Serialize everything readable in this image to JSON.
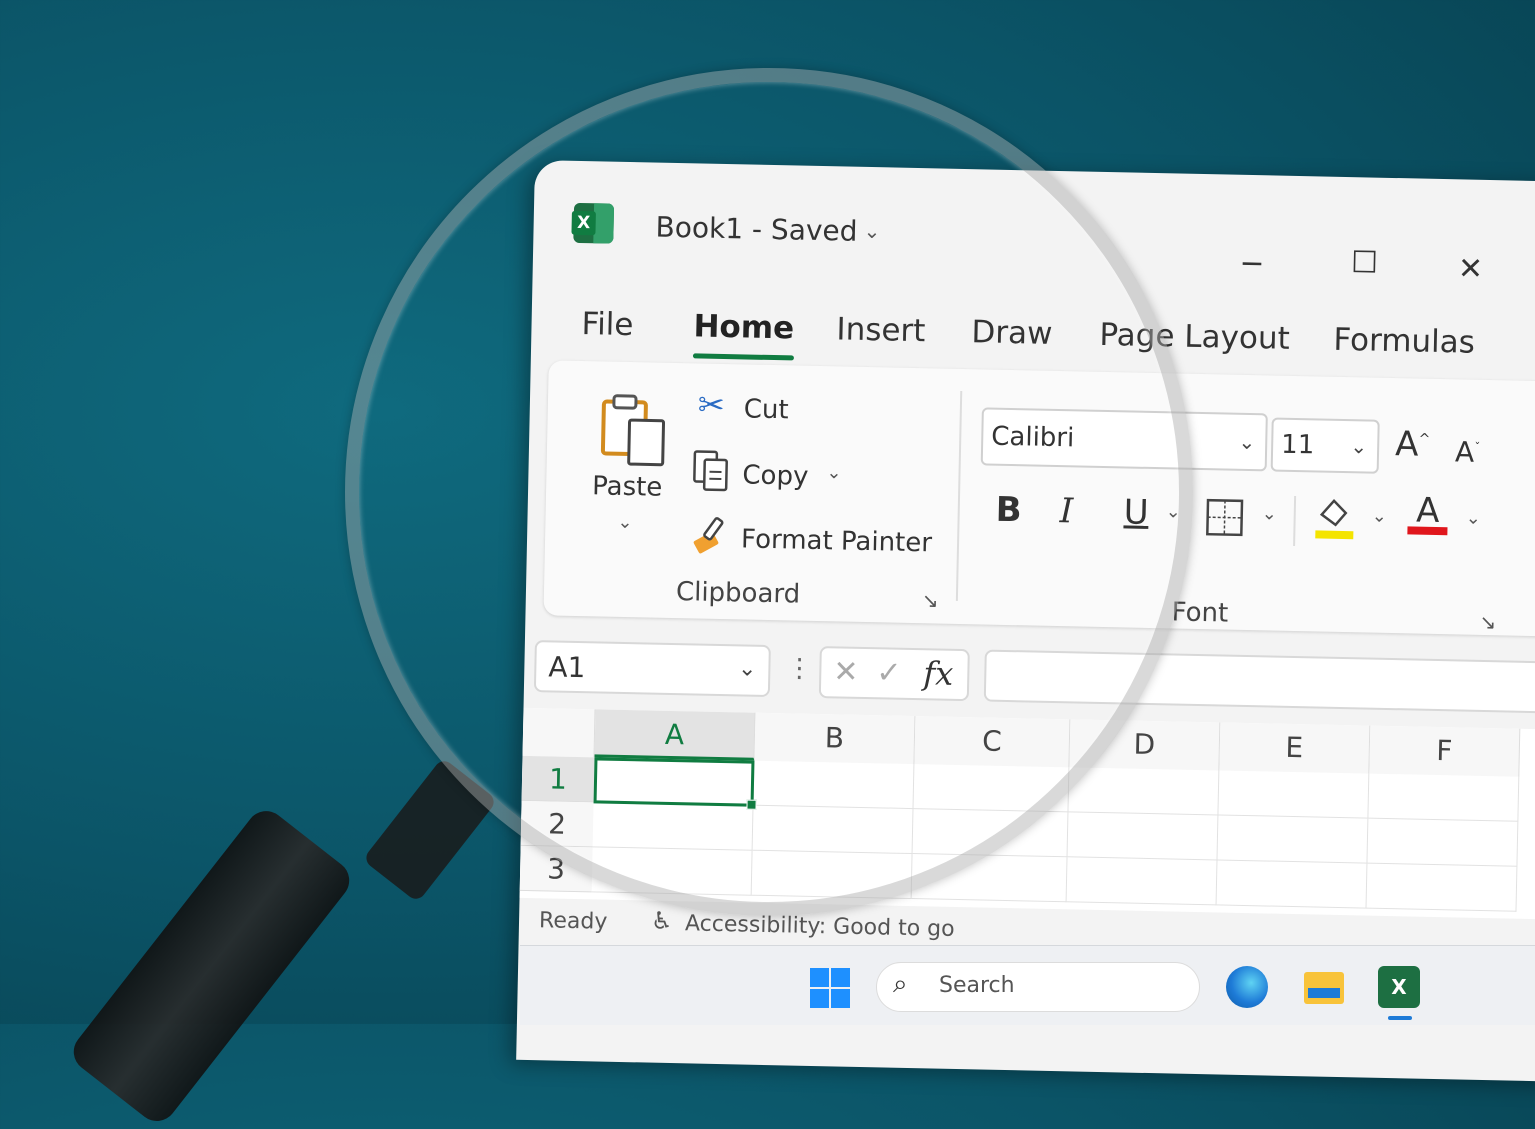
{
  "window": {
    "doc_title": "Book1 - Saved",
    "minimize_glyph": "─",
    "maximize_glyph": "☐",
    "close_glyph": "✕"
  },
  "tabs": [
    {
      "label": "File"
    },
    {
      "label": "Home",
      "active": true
    },
    {
      "label": "Insert"
    },
    {
      "label": "Draw"
    },
    {
      "label": "Page Layout"
    },
    {
      "label": "Formulas"
    }
  ],
  "clipboard": {
    "paste": "Paste",
    "cut": "Cut",
    "copy": "Copy",
    "format_painter": "Format Painter",
    "group_label": "Clipboard"
  },
  "font": {
    "font_name": "Calibri",
    "font_size": "11",
    "bold": "B",
    "italic": "I",
    "underline": "U",
    "font_color_glyph": "A",
    "group_label": "Font",
    "highlight_color": "#f4e400",
    "font_color": "#e0161c"
  },
  "formula_bar": {
    "name_box": "A1",
    "fx": "fx",
    "formula_value": ""
  },
  "grid": {
    "columns": [
      "A",
      "B",
      "C",
      "D",
      "E",
      "F"
    ],
    "rows": [
      "1",
      "2",
      "3"
    ],
    "selected_cell": "A1"
  },
  "status": {
    "ready": "Ready",
    "accessibility": "Accessibility: Good to go"
  },
  "taskbar": {
    "search_placeholder": "Search"
  },
  "colors": {
    "accent": "#107c41",
    "background": "#0b5467"
  }
}
